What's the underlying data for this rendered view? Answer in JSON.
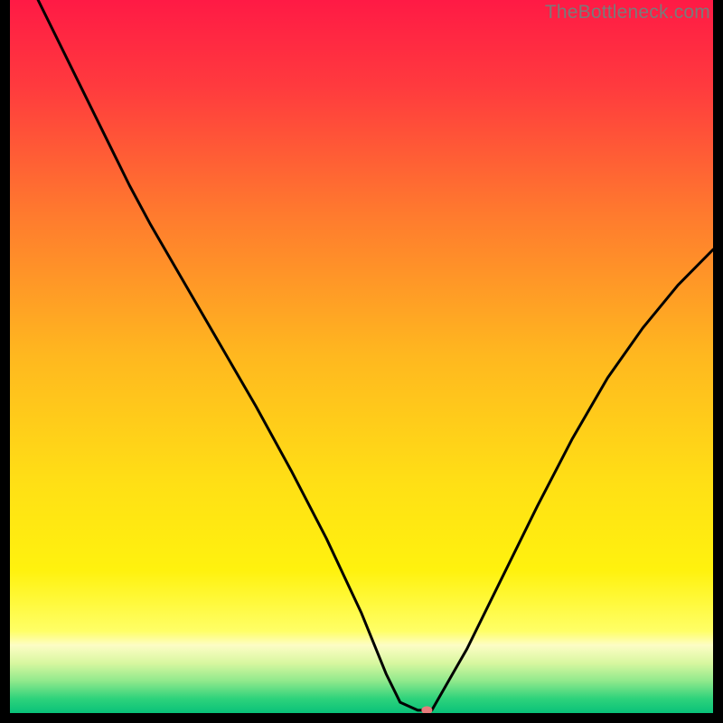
{
  "watermark": "TheBottleneck.com",
  "chart_data": {
    "type": "line",
    "title": "",
    "xlabel": "",
    "ylabel": "",
    "xlim": [
      0,
      100
    ],
    "ylim": [
      0,
      100
    ],
    "gradient_stops": [
      {
        "offset": 0.0,
        "color": "#ff1a45"
      },
      {
        "offset": 0.12,
        "color": "#ff3a3e"
      },
      {
        "offset": 0.3,
        "color": "#ff7a2e"
      },
      {
        "offset": 0.5,
        "color": "#ffb81f"
      },
      {
        "offset": 0.68,
        "color": "#ffe015"
      },
      {
        "offset": 0.8,
        "color": "#fff20e"
      },
      {
        "offset": 0.885,
        "color": "#ffff66"
      },
      {
        "offset": 0.905,
        "color": "#fdfdc5"
      },
      {
        "offset": 0.93,
        "color": "#d8f7a0"
      },
      {
        "offset": 0.955,
        "color": "#90e98c"
      },
      {
        "offset": 0.98,
        "color": "#2dd27b"
      },
      {
        "offset": 1.0,
        "color": "#09c27a"
      }
    ],
    "series": [
      {
        "name": "bottleneck-curve",
        "x": [
          4,
          10,
          17,
          20,
          25,
          30,
          35,
          40,
          45,
          50,
          53.5,
          55.5,
          58,
          60,
          65,
          70,
          75,
          80,
          85,
          90,
          95,
          100
        ],
        "y": [
          100,
          88,
          74,
          68.5,
          60,
          51.5,
          43,
          34,
          24.5,
          14,
          5.5,
          1.5,
          0.4,
          0.4,
          9,
          19,
          29,
          38.5,
          47,
          54,
          60,
          65
        ]
      }
    ],
    "marker": {
      "x": 59.3,
      "y": 0.4,
      "color": "#e77c7c",
      "rx": 6,
      "ry": 4.5
    }
  }
}
